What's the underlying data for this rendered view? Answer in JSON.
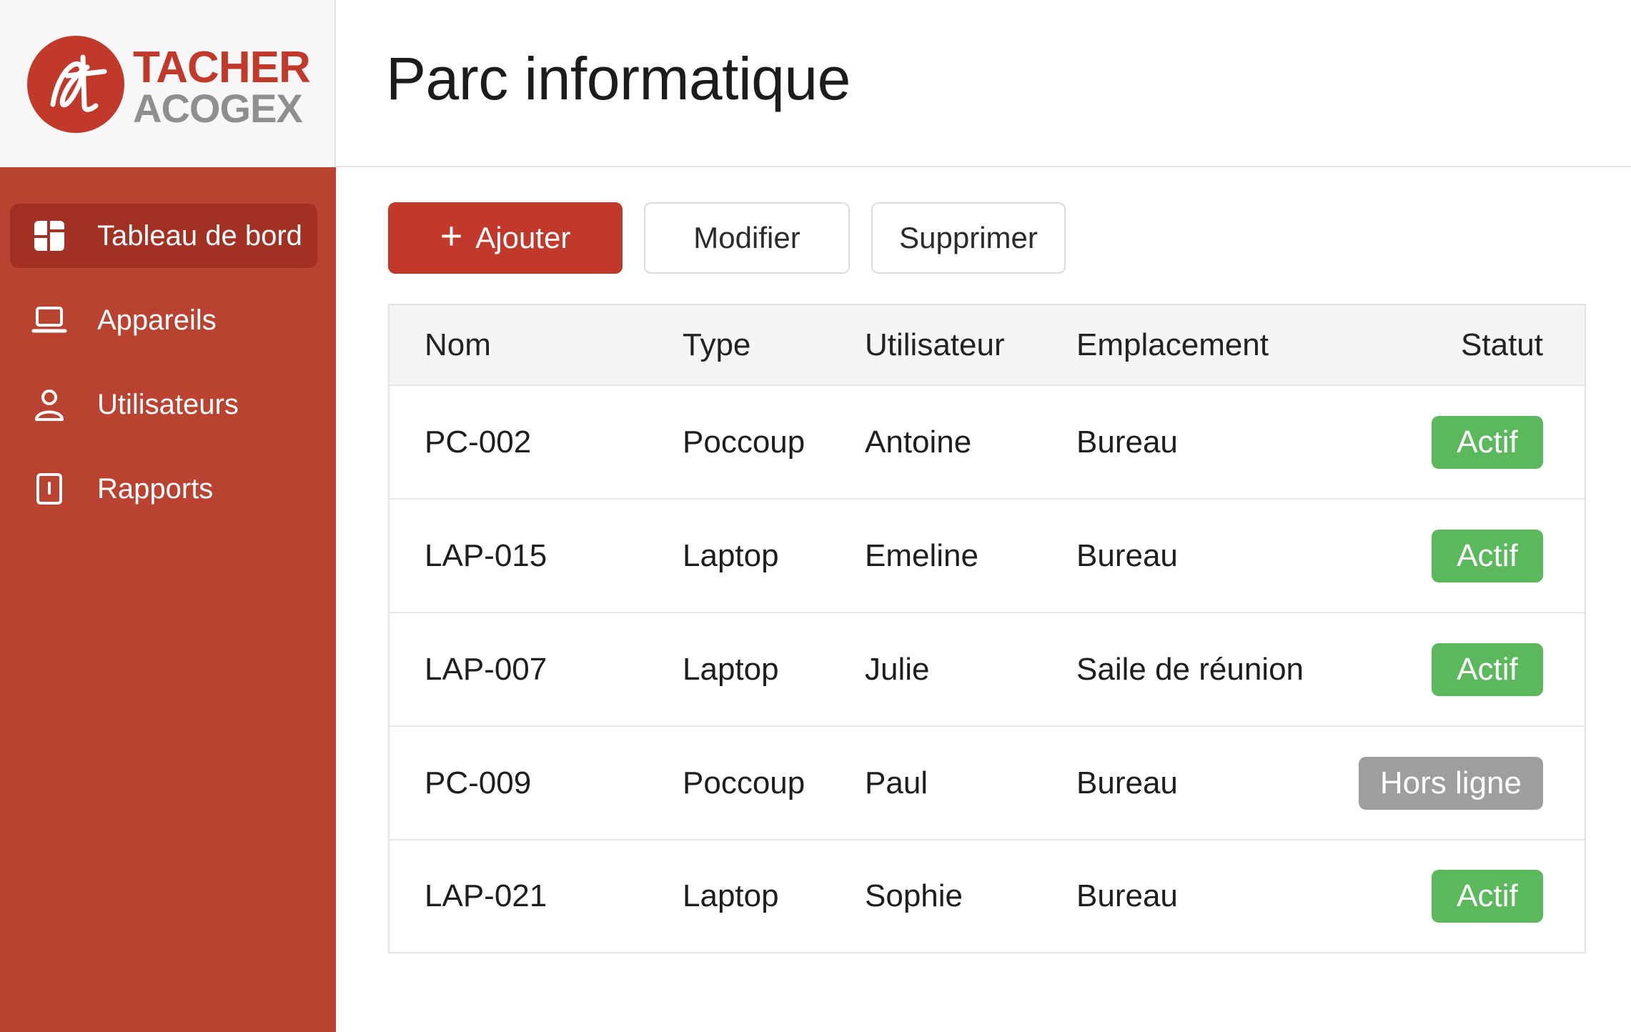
{
  "brand": {
    "logo_line1": "TACHER",
    "logo_line2": "ACOGEX",
    "primary_color": "#c0392b",
    "sidebar_color": "#b94231"
  },
  "sidebar": {
    "items": [
      {
        "label": "Tableau de bord",
        "icon": "dashboard-icon",
        "active": true
      },
      {
        "label": "Appareils",
        "icon": "laptop-icon",
        "active": false
      },
      {
        "label": "Utilisateurs",
        "icon": "user-icon",
        "active": false
      },
      {
        "label": "Rapports",
        "icon": "report-icon",
        "active": false
      }
    ]
  },
  "header": {
    "title": "Parc informatique"
  },
  "toolbar": {
    "add_icon": "+",
    "add_label": "Ajouter",
    "modify_label": "Modifier",
    "delete_label": "Supprimer"
  },
  "table": {
    "columns": [
      "Nom",
      "Type",
      "Utilisateur",
      "Emplacement",
      "Statut"
    ],
    "rows": [
      {
        "nom": "PC-002",
        "type": "Poccoup",
        "utilisateur": "Antoine",
        "emplacement": "Bureau",
        "statut": "Actif"
      },
      {
        "nom": "LAP-015",
        "type": "Laptop",
        "utilisateur": "Emeline",
        "emplacement": "Bureau",
        "statut": "Actif"
      },
      {
        "nom": "LAP-007",
        "type": "Laptop",
        "utilisateur": "Julie",
        "emplacement": "Saile de réunion",
        "statut": "Actif"
      },
      {
        "nom": "PC-009",
        "type": "Poccoup",
        "utilisateur": "Paul",
        "emplacement": "Bureau",
        "statut": "Hors ligne"
      },
      {
        "nom": "LAP-021",
        "type": "Laptop",
        "utilisateur": "Sophie",
        "emplacement": "Bureau",
        "statut": "Actif"
      }
    ],
    "status_colors": {
      "active": "#5cb85c",
      "offline": "#9e9e9e"
    }
  }
}
